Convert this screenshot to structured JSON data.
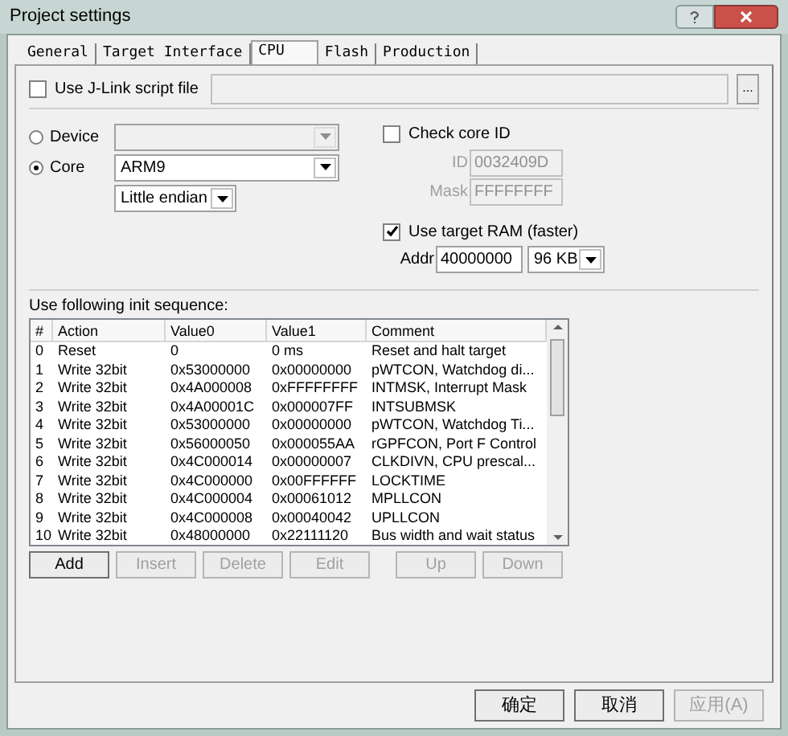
{
  "window": {
    "title": "Project settings"
  },
  "tabs": [
    {
      "label": "General",
      "selected": false
    },
    {
      "label": "Target Interface",
      "selected": false
    },
    {
      "label": "CPU",
      "selected": true
    },
    {
      "label": "Flash",
      "selected": false
    },
    {
      "label": "Production",
      "selected": false
    }
  ],
  "script_file": {
    "label": "Use J-Link script file",
    "checked": false,
    "browse": "..."
  },
  "target": [
    {
      "label": "Device",
      "selected": false,
      "disabled": true
    },
    {
      "label": "Core",
      "selected": true,
      "value": "ARM9",
      "disabled": false
    }
  ],
  "endian": {
    "value": "Little endian"
  },
  "core_id": {
    "label": "Check core ID",
    "checked": false,
    "id_label": "ID",
    "id_value": "0032409D",
    "mask_label": "Mask",
    "mask_value": "FFFFFFFF"
  },
  "target_ram": {
    "label": "Use target RAM (faster)",
    "checked": true,
    "addr_label": "Addr",
    "addr_value": "40000000",
    "size": "96 KB"
  },
  "init_sequence": {
    "label": "Use following init sequence:",
    "columns": [
      "#",
      "Action",
      "Value0",
      "Value1",
      "Comment"
    ],
    "rows": [
      [
        "0",
        "Reset",
        "0",
        "0 ms",
        "Reset and halt target"
      ],
      [
        "1",
        "Write 32bit",
        "0x53000000",
        "0x00000000",
        "pWTCON, Watchdog di..."
      ],
      [
        "2",
        "Write 32bit",
        "0x4A000008",
        "0xFFFFFFFF",
        "INTMSK, Interrupt Mask"
      ],
      [
        "3",
        "Write 32bit",
        "0x4A00001C",
        "0x000007FF",
        "INTSUBMSK"
      ],
      [
        "4",
        "Write 32bit",
        "0x53000000",
        "0x00000000",
        "pWTCON, Watchdog Ti..."
      ],
      [
        "5",
        "Write 32bit",
        "0x56000050",
        "0x000055AA",
        "rGPFCON, Port F Control"
      ],
      [
        "6",
        "Write 32bit",
        "0x4C000014",
        "0x00000007",
        "CLKDIVN, CPU prescal..."
      ],
      [
        "7",
        "Write 32bit",
        "0x4C000000",
        "0x00FFFFFF",
        "LOCKTIME"
      ],
      [
        "8",
        "Write 32bit",
        "0x4C000004",
        "0x00061012",
        "MPLLCON"
      ],
      [
        "9",
        "Write 32bit",
        "0x4C000008",
        "0x00040042",
        "UPLLCON"
      ],
      [
        "10",
        "Write 32bit",
        "0x48000000",
        "0x22111120",
        "Bus width and wait status"
      ]
    ],
    "buttons": [
      {
        "label": "Add",
        "disabled": false
      },
      {
        "label": "Insert",
        "disabled": true
      },
      {
        "label": "Delete",
        "disabled": true
      },
      {
        "label": "Edit",
        "disabled": true
      },
      {
        "label": "Up",
        "disabled": true
      },
      {
        "label": "Down",
        "disabled": true
      }
    ]
  },
  "dialog_buttons": [
    {
      "label": "确定",
      "disabled": false
    },
    {
      "label": "取消",
      "disabled": false
    },
    {
      "label": "应用(A)",
      "disabled": true
    }
  ]
}
